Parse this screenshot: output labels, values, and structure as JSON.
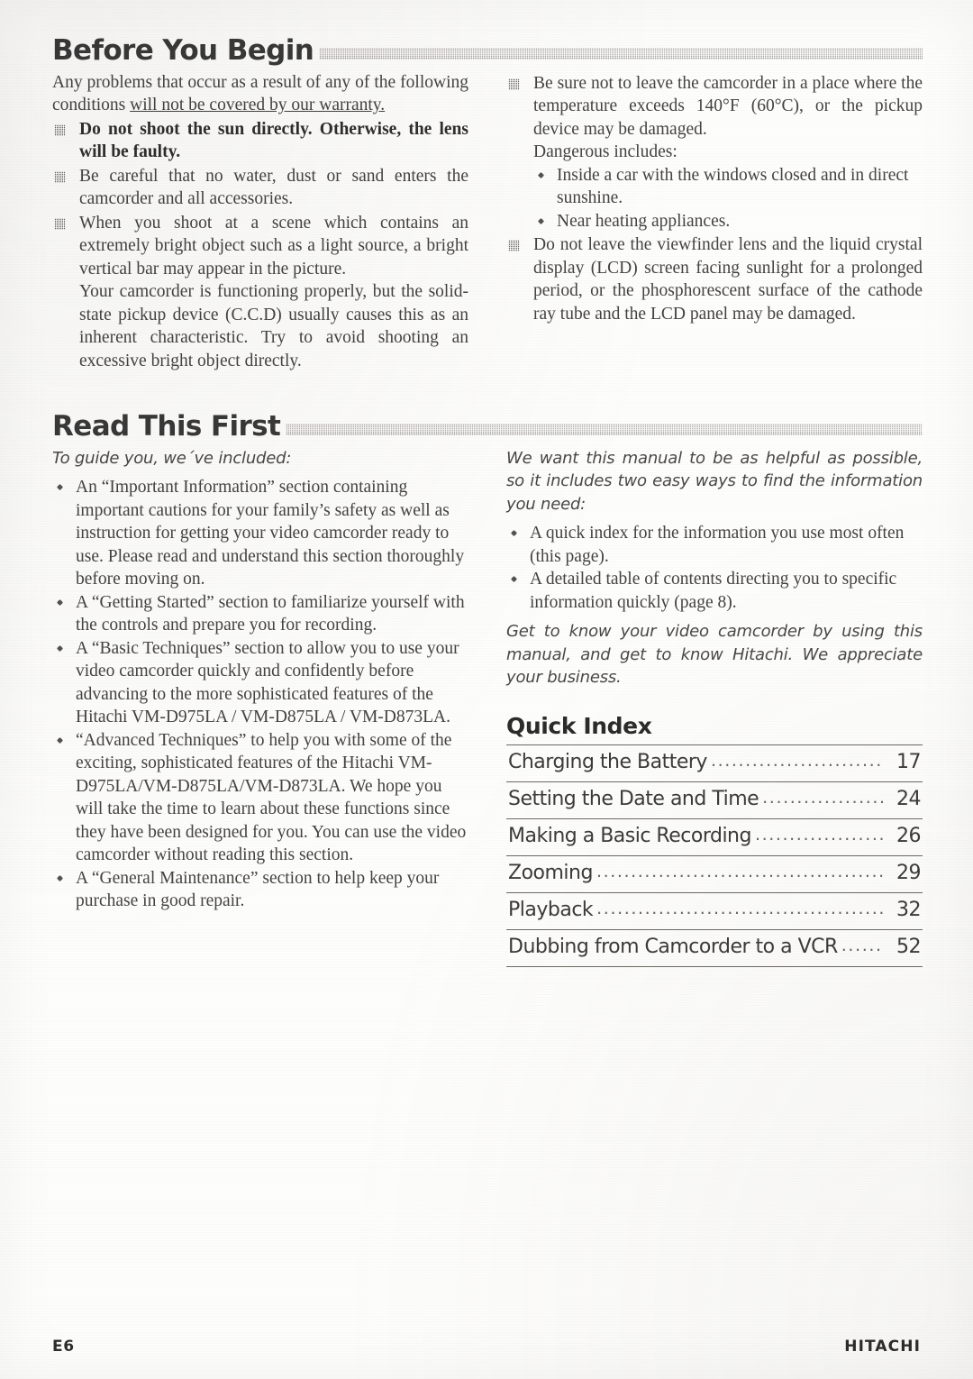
{
  "document": {
    "page_label": "E6",
    "brand": "HITACHI"
  },
  "sections": [
    {
      "title": "Before You Begin",
      "left": {
        "lead_prefix": "Any problems that occur as a result of any of the following conditions ",
        "lead_underlined": "will not be covered by our warranty.",
        "bullets": [
          "Do not shoot the sun directly.  Otherwise, the lens will be faulty.",
          "Be careful that no water, dust or sand enters  the camcorder and all accessories.",
          "When you shoot at a scene which contains an extremely bright object such as a light source, a bright vertical bar may appear in the picture."
        ],
        "bullet3_continuation": "Your camcorder is functioning properly, but the solid-state pickup device (C.C.D) usually causes this as an inherent characteristic.  Try to avoid shooting an excessive bright object directly."
      },
      "right": {
        "bullet1": "Be sure not to leave the camcorder in a place where the temperature exceeds 140°F (60°C), or the pickup device may be damaged.",
        "dangerous_label": "Dangerous includes:",
        "dangerous_items": [
          "Inside a car with the windows closed and in direct sunshine.",
          "Near heating appliances."
        ],
        "bullet2": "Do not leave the viewfinder lens and the liquid crystal display (LCD) screen facing sunlight for a prolonged period, or the phosphorescent surface of the cathode ray tube and the LCD panel may be damaged."
      }
    },
    {
      "title": "Read This First",
      "left": {
        "intro_italic": "To guide you, we´ve included:",
        "bullets": [
          "An “Important Information” section containing important cautions for your family’s safety as well as instruction for getting your video camcorder ready to use.  Please read and understand this section thoroughly before moving on.",
          "A “Getting Started” section to familiarize yourself with the controls and prepare you for recording.",
          "A “Basic Techniques” section to allow you to use your video camcorder quickly and confidently before advancing to the more sophisticated features of the Hitachi VM-D975LA / VM-D875LA / VM-D873LA.",
          "“Advanced Techniques” to help you with some of the exciting, sophisticated features of the Hitachi VM-D975LA/VM-D875LA/VM-D873LA. We hope you will take the time to learn about these functions since they have been designed for you. You can use the video camcorder without reading this section.",
          "A “General Maintenance” section to help keep your purchase in good repair."
        ]
      },
      "right": {
        "intro_italic": "We want this manual to be as helpful as possible, so it includes two easy ways to find the information you need:",
        "bullets": [
          "A quick index for the information you use most often (this page).",
          "A detailed table of contents directing you to specific information quickly (page 8)."
        ],
        "closing_italic": "Get to know your video camcorder by using this manual, and get to know Hitachi. We appreciate your business.",
        "quick_index": {
          "title": "Quick Index",
          "entries": [
            {
              "label": "Charging the Battery",
              "page": "17"
            },
            {
              "label": "Setting the Date and Time",
              "page": "24"
            },
            {
              "label": "Making a Basic Recording",
              "page": "26"
            },
            {
              "label": "Zooming",
              "page": "29"
            },
            {
              "label": "Playback",
              "page": "32"
            },
            {
              "label": "Dubbing from Camcorder to a VCR",
              "page": "52"
            }
          ]
        }
      }
    }
  ],
  "dots": "..............................................................................."
}
